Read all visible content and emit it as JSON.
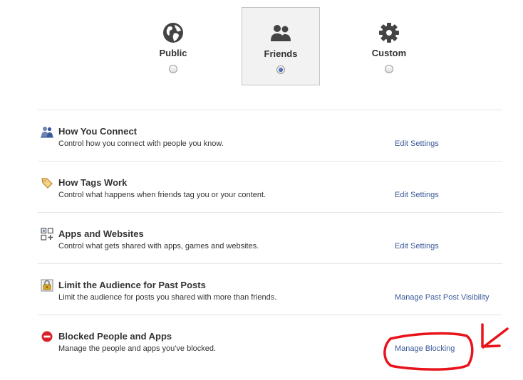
{
  "audience": [
    {
      "label": "Public",
      "icon": "globe-icon",
      "selected": false
    },
    {
      "label": "Friends",
      "icon": "friends-icon",
      "selected": true
    },
    {
      "label": "Custom",
      "icon": "gear-icon",
      "selected": false
    }
  ],
  "sections": [
    {
      "title": "How You Connect",
      "desc": "Control how you connect with people you know.",
      "link": "Edit Settings",
      "icon": "people-icon"
    },
    {
      "title": "How Tags Work",
      "desc": "Control what happens when friends tag you or your content.",
      "link": "Edit Settings",
      "icon": "tag-icon"
    },
    {
      "title": "Apps and Websites",
      "desc": "Control what gets shared with apps, games and websites.",
      "link": "Edit Settings",
      "icon": "apps-icon"
    },
    {
      "title": "Limit the Audience for Past Posts",
      "desc": "Limit the audience for posts you shared with more than friends.",
      "link": "Manage Past Post Visibility",
      "icon": "lock-icon"
    },
    {
      "title": "Blocked People and Apps",
      "desc": "Manage the people and apps you've blocked.",
      "link": "Manage Blocking",
      "icon": "block-icon"
    }
  ],
  "colors": {
    "link": "#3b5998",
    "annotation": "#e8131b"
  }
}
